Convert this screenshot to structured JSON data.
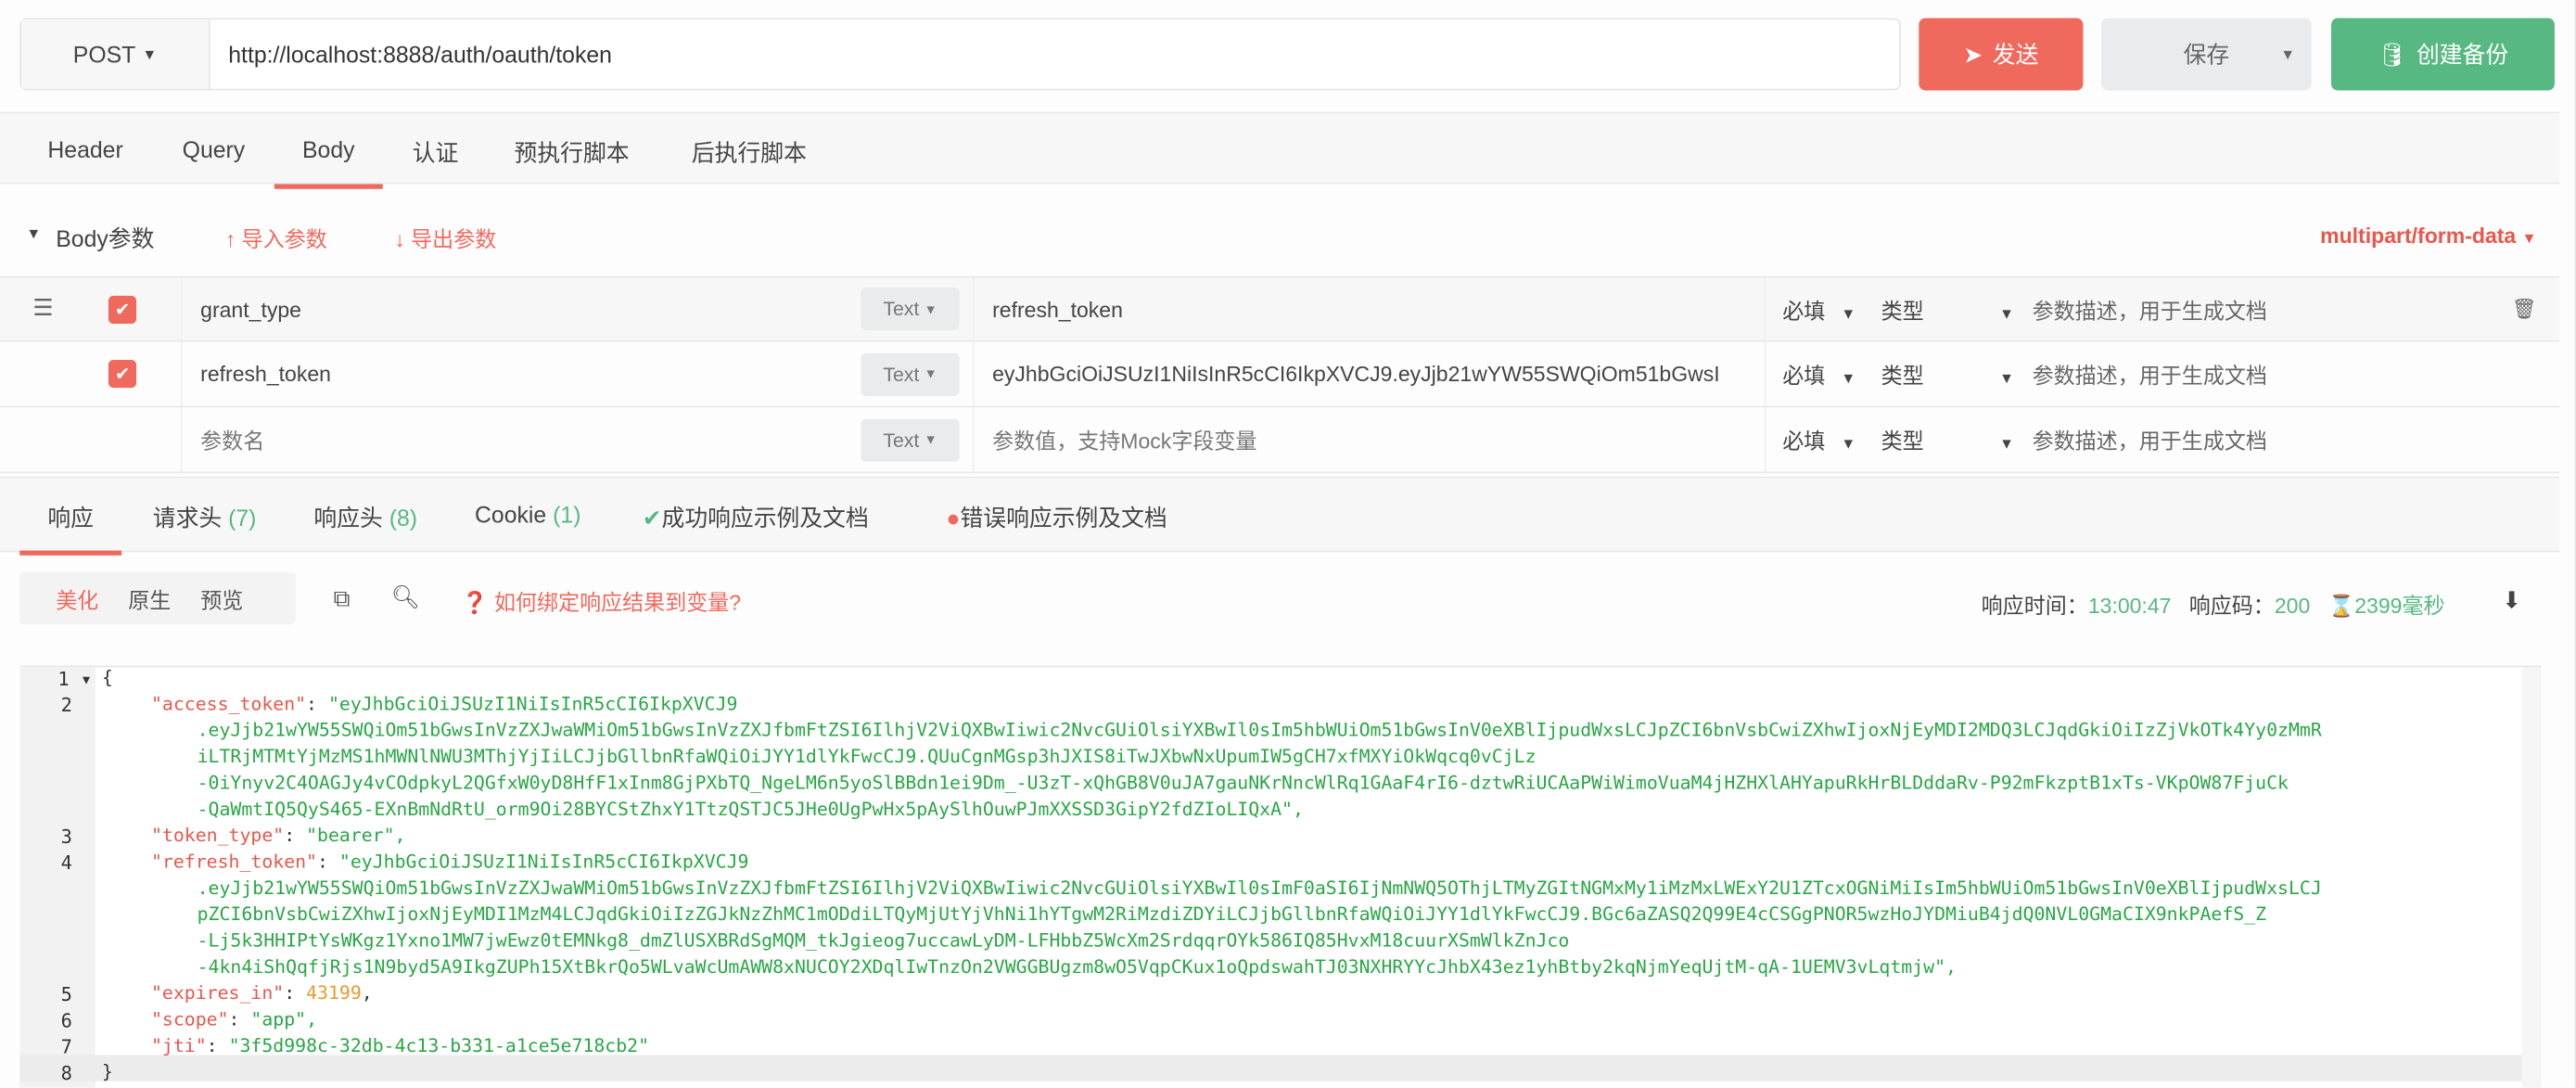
{
  "request": {
    "method": "POST",
    "url": "http://localhost:8888/auth/oauth/token",
    "send_label": "发送",
    "save_label": "保存",
    "backup_label": "创建备份"
  },
  "colors": {
    "accent": "#f0695d",
    "success": "#57b882",
    "string": "#28a745",
    "key": "#e8574b",
    "number": "#e89a2c"
  },
  "request_tabs": [
    {
      "label": "Header"
    },
    {
      "label": "Query"
    },
    {
      "label": "Body",
      "active": true
    },
    {
      "label": "认证"
    },
    {
      "label": "预执行脚本"
    },
    {
      "label": "后执行脚本"
    }
  ],
  "body": {
    "title": "Body参数",
    "import_label": "导入参数",
    "export_label": "导出参数",
    "content_type": "multipart/form-data",
    "params": [
      {
        "checked": true,
        "name": "grant_type",
        "type": "Text",
        "value": "refresh_token",
        "required": "必填",
        "datatype": "类型",
        "desc": "参数描述，用于生成文档"
      },
      {
        "checked": true,
        "name": "refresh_token",
        "type": "Text",
        "value": "eyJhbGciOiJSUzI1NiIsInR5cCI6IkpXVCJ9.eyJjb21wYW55SWQiOm51bGwsI",
        "required": "必填",
        "datatype": "类型",
        "desc": "参数描述，用于生成文档"
      }
    ],
    "new_param": {
      "name_placeholder": "参数名",
      "type": "Text",
      "value_placeholder": "参数值，支持Mock字段变量",
      "required": "必填",
      "datatype": "类型",
      "desc": "参数描述，用于生成文档"
    }
  },
  "response_tabs": [
    {
      "label": "响应",
      "active": true
    },
    {
      "label": "请求头",
      "count": "(7)"
    },
    {
      "label": "响应头",
      "count": "(8)"
    },
    {
      "label": "Cookie",
      "count": "(1)"
    },
    {
      "label": "成功响应示例及文档",
      "icon": "check-circle"
    },
    {
      "label": "错误响应示例及文档",
      "icon": "exclamation-circle"
    }
  ],
  "response_toolbar": {
    "modes": [
      "美化",
      "原生",
      "预览"
    ],
    "active_mode": "美化",
    "help_link": "如何绑定响应结果到变量?",
    "time_label": "响应时间：",
    "time": "13:00:47",
    "code_label": "响应码：",
    "code": "200",
    "duration": "2399毫秒"
  },
  "response_body": {
    "open": "{",
    "close": "}",
    "access_token_key": "\"access_token\"",
    "access_token": [
      "\"eyJhbGciOiJSUzI1NiIsInR5cCI6IkpXVCJ9",
      ".eyJjb21wYW55SWQiOm51bGwsInVzZXJwaWMiOm51bGwsInVzZXJfbmFtZSI6IlhjV2ViQXBwIiwic2NvcGUiOlsiYXBwIl0sIm5hbWUiOm51bGwsInV0eXBlIjpudWxsLCJpZCI6bnVsbCwiZXhwIjoxNjEyMDI2MDQ3LCJqdGkiOiIzZjVkOTk4Yy0zMmR",
      "iLTRjMTMtYjMzMS1hMWNlNWU3MThjYjIiLCJjbGllbnRfaWQiOiJYY1dlYkFwcCJ9.QUuCgnMGsp3hJXIS8iTwJXbwNxUpumIW5gCH7xfMXYiOkWqcq0vCjLz",
      "-0iYnyv2C4OAGJy4vCOdpkyL2QGfxW0yD8HfF1xInm8GjPXbTQ_NgeLM6n5yoSlBBdn1ei9Dm_-U3zT-xQhGB8V0uJA7gauNKrNncWlRq1GAaF4rI6-dztwRiUCAaPWiWimoVuaM4jHZHXlAHYapuRkHrBLDddaRv-P92mFkzptB1xTs-VKpOW87FjuCk",
      "-QaWmtIQ5QyS465-EXnBmNdRtU_orm9Oi28BYCStZhxY1TtzQSTJC5JHe0UgPwHx5pAySlhOuwPJmXXSSD3GipY2fdZIoLIQxA\","
    ],
    "token_type_key": "\"token_type\"",
    "token_type": "\"bearer\",",
    "refresh_token_key": "\"refresh_token\"",
    "refresh_token": [
      "\"eyJhbGciOiJSUzI1NiIsInR5cCI6IkpXVCJ9",
      ".eyJjb21wYW55SWQiOm51bGwsInVzZXJwaWMiOm51bGwsInVzZXJfbmFtZSI6IlhjV2ViQXBwIiwic2NvcGUiOlsiYXBwIl0sImF0aSI6IjNmNWQ5OThjLTMyZGItNGMxMy1iMzMxLWExY2U1ZTcxOGNiMiIsIm5hbWUiOm51bGwsInV0eXBlIjpudWxsLCJ",
      "pZCI6bnVsbCwiZXhwIjoxNjEyMDI1MzM4LCJqdGkiOiIzZGJkNzZhMC1mODdiLTQyMjUtYjVhNi1hYTgwM2RiMzdiZDYiLCJjbGllbnRfaWQiOiJYY1dlYkFwcCJ9.BGc6aZASQ2Q99E4cCSGgPNOR5wzHoJYDMiuB4jdQ0NVL0GMaCIX9nkPAefS_Z",
      "-Lj5k3HHIPtYsWKgz1Yxno1MW7jwEwz0tEMNkg8_dmZlUSXBRdSgMQM_tkJgieog7uccawLyDM-LFHbbZ5WcXm2SrdqqrOYk586IQ85HvxM18cuurXSmWlkZnJco",
      "-4kn4iShQqfjRjs1N9byd5A9IkgZUPh15XtBkrQo5WLvaWcUmAWW8xNUCOY2XDqlIwTnzOn2VWGGBUgzm8wO5VqpCKux1oQpdswahTJ03NXHRYYcJhbX43ez1yhBtby2kqNjmYeqUjtM-qA-1UEMV3vLqtmjw\","
    ],
    "expires_in_key": "\"expires_in\"",
    "expires_in": "43199",
    "scope_key": "\"scope\"",
    "scope": "\"app\",",
    "jti_key": "\"jti\"",
    "jti": "\"3f5d998c-32db-4c13-b331-a1ce5e718cb2\""
  }
}
